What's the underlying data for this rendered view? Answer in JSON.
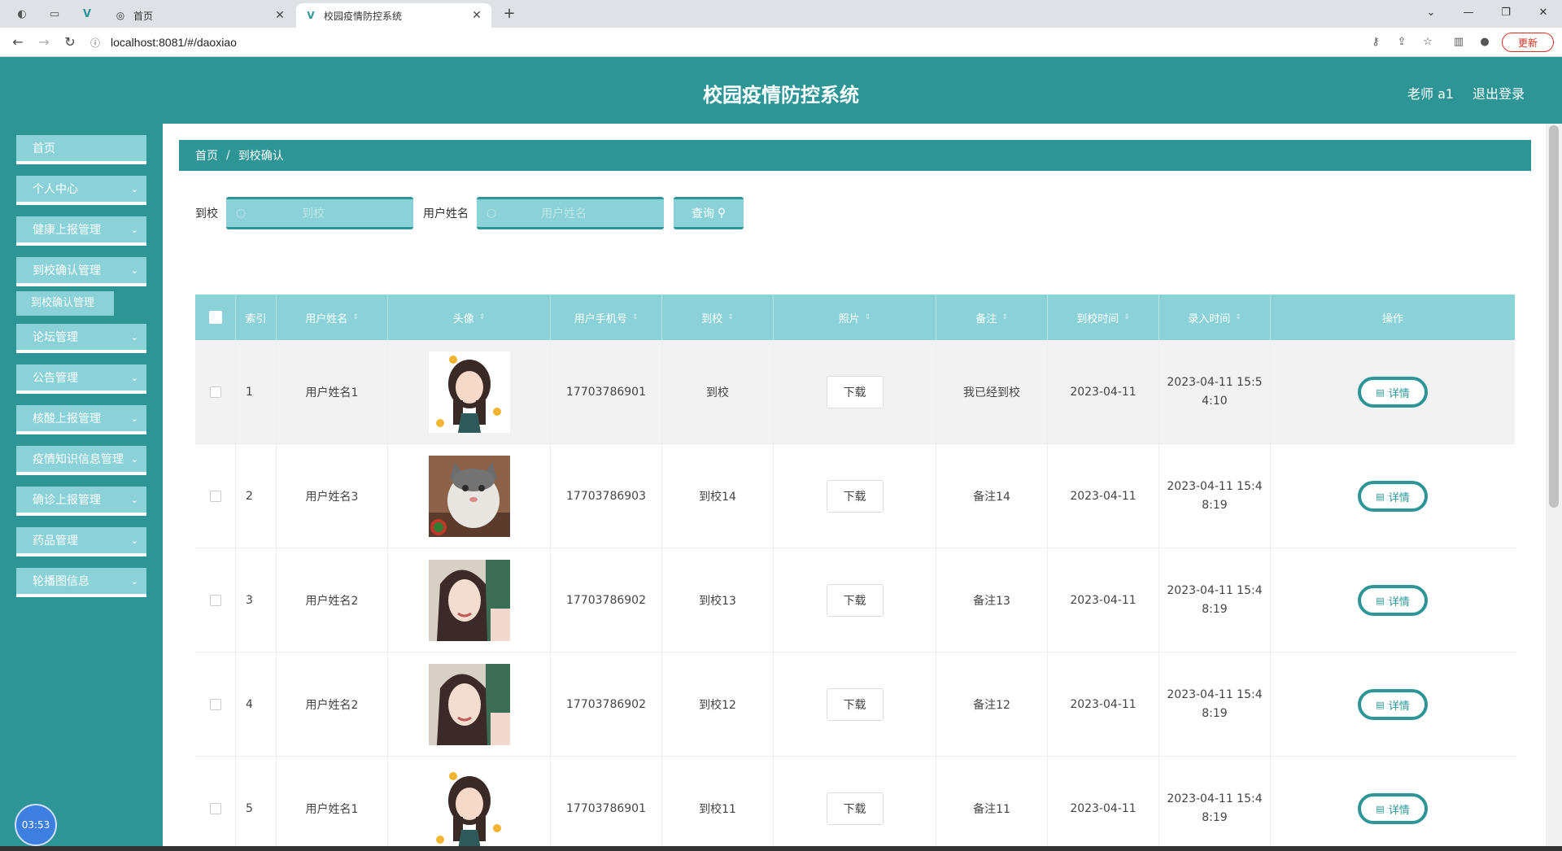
{
  "browser": {
    "tabs": [
      {
        "title": "首页",
        "active": false
      },
      {
        "title": "校园疫情防控系统",
        "active": true
      }
    ],
    "url": "localhost:8081/#/daoxiao",
    "update_label": "更新"
  },
  "header": {
    "title": "校园疫情防控系统",
    "user": "老师 a1",
    "logout": "退出登录"
  },
  "sidebar": {
    "items": [
      {
        "label": "首页",
        "has_children": false
      },
      {
        "label": "个人中心",
        "has_children": true
      },
      {
        "label": "健康上报管理",
        "has_children": true
      },
      {
        "label": "到校确认管理",
        "has_children": true
      },
      {
        "label": "论坛管理",
        "has_children": true
      },
      {
        "label": "公告管理",
        "has_children": true
      },
      {
        "label": "核酸上报管理",
        "has_children": true
      },
      {
        "label": "疫情知识信息管理",
        "has_children": true
      },
      {
        "label": "确诊上报管理",
        "has_children": true
      },
      {
        "label": "药品管理",
        "has_children": true
      },
      {
        "label": "轮播图信息",
        "has_children": true
      }
    ],
    "sub_item": "到校确认管理",
    "timer": "03:53"
  },
  "breadcrumb": {
    "home": "首页",
    "sep": "/",
    "current": "到校确认"
  },
  "search": {
    "daoxiao_label": "到校",
    "daoxiao_placeholder": "到校",
    "name_label": "用户姓名",
    "name_placeholder": "用户姓名",
    "button": "查询"
  },
  "table": {
    "columns": [
      "索引",
      "用户姓名",
      "头像",
      "用户手机号",
      "到校",
      "照片",
      "备注",
      "到校时间",
      "录入时间",
      "操作"
    ],
    "download_label": "下载",
    "detail_label": "详情",
    "rows": [
      {
        "index": "1",
        "name": "用户姓名1",
        "avatar": "girl-cartoon",
        "phone": "17703786901",
        "daoxiao": "到校",
        "note": "我已经到校",
        "date": "2023-04-11",
        "created_line1": "2023-04-11 15:5",
        "created_line2": "4:10"
      },
      {
        "index": "2",
        "name": "用户姓名3",
        "avatar": "cat",
        "phone": "17703786903",
        "daoxiao": "到校14",
        "note": "备注14",
        "date": "2023-04-11",
        "created_line1": "2023-04-11 15:4",
        "created_line2": "8:19"
      },
      {
        "index": "3",
        "name": "用户姓名2",
        "avatar": "woman-painting",
        "phone": "17703786902",
        "daoxiao": "到校13",
        "note": "备注13",
        "date": "2023-04-11",
        "created_line1": "2023-04-11 15:4",
        "created_line2": "8:19"
      },
      {
        "index": "4",
        "name": "用户姓名2",
        "avatar": "woman-painting",
        "phone": "17703786902",
        "daoxiao": "到校12",
        "note": "备注12",
        "date": "2023-04-11",
        "created_line1": "2023-04-11 15:4",
        "created_line2": "8:19"
      },
      {
        "index": "5",
        "name": "用户姓名1",
        "avatar": "girl-cartoon",
        "phone": "17703786901",
        "daoxiao": "到校11",
        "note": "备注11",
        "date": "2023-04-11",
        "created_line1": "2023-04-11 15:4",
        "created_line2": "8:19"
      }
    ]
  },
  "colors": {
    "primary": "#2d9596",
    "accent_light": "#8ad2d7"
  }
}
